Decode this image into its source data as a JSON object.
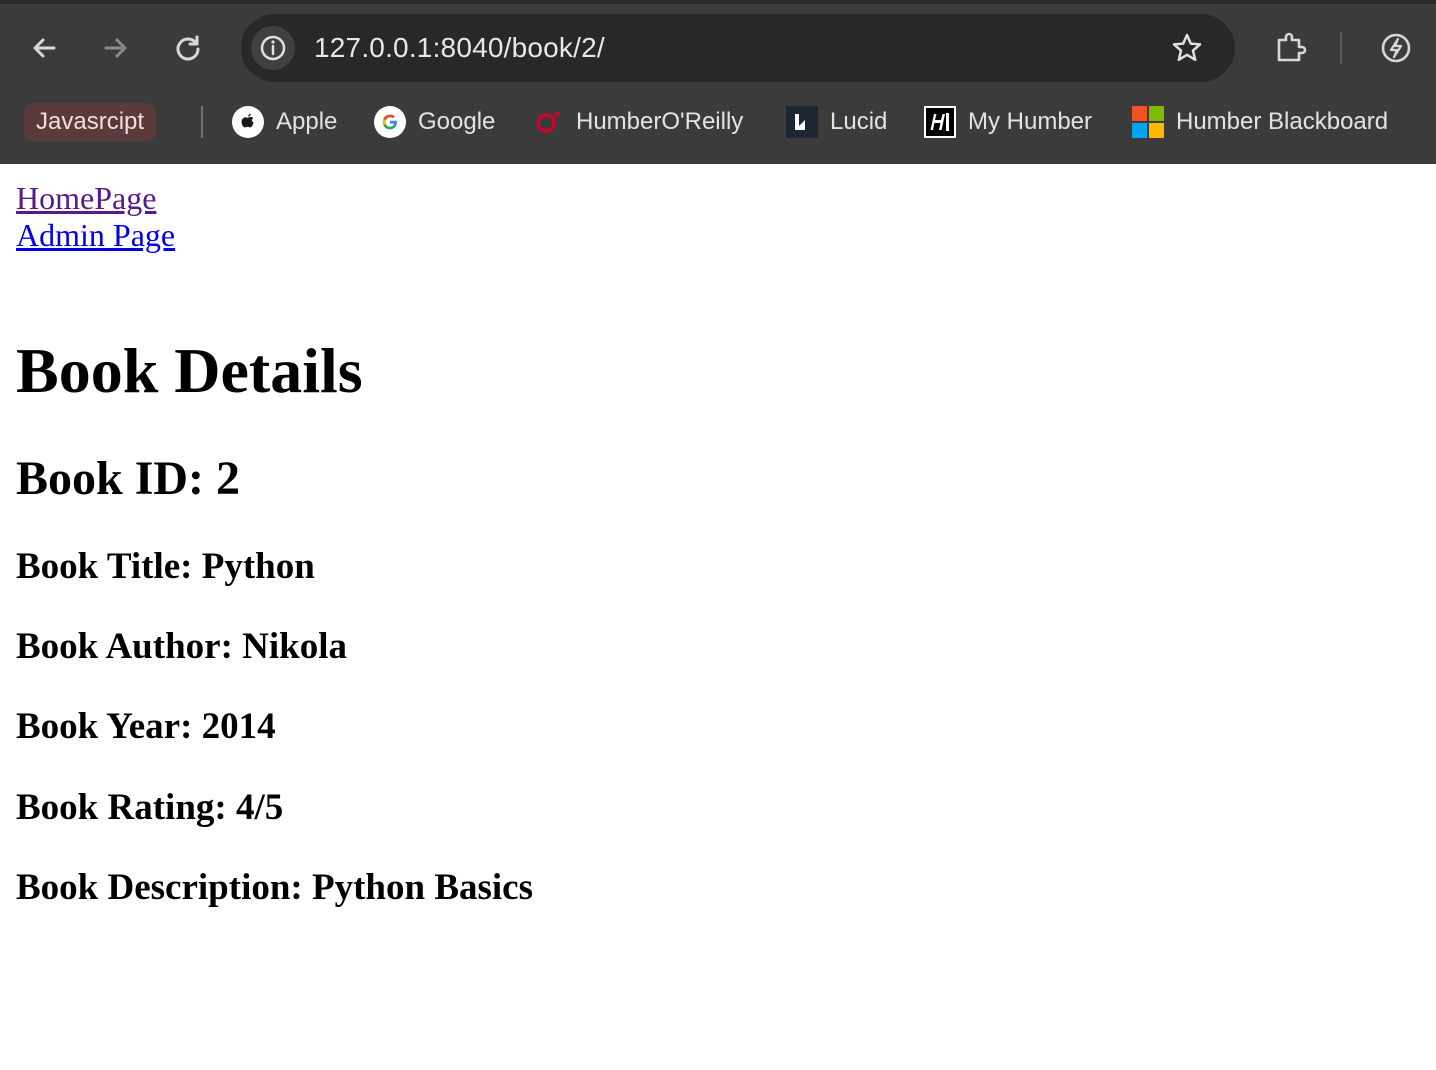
{
  "browser": {
    "url": "127.0.0.1:8040/book/2/",
    "bookmarks": {
      "folder_label": "Javasrcipt",
      "items": [
        {
          "label": "Apple",
          "icon": "apple-icon"
        },
        {
          "label": "Google",
          "icon": "google-icon"
        },
        {
          "label": "HumberO'Reilly",
          "icon": "oreilly-icon"
        },
        {
          "label": "Lucid",
          "icon": "lucid-icon"
        },
        {
          "label": "My Humber",
          "icon": "humber-icon"
        },
        {
          "label": "Humber Blackboard",
          "icon": "microsoft-icon"
        }
      ]
    },
    "toolbar_icons": [
      "back-arrow-icon",
      "forward-arrow-icon",
      "reload-icon",
      "site-info-icon",
      "bookmark-star-icon",
      "extensions-puzzle-icon",
      "performance-leaf-icon"
    ]
  },
  "page": {
    "nav_links": {
      "home": "HomePage",
      "admin": "Admin Page"
    },
    "heading": "Book Details",
    "book_id": "Book ID: 2",
    "title": "Book Title: Python",
    "author": "Book Author: Nikola",
    "year": "Book Year: 2014",
    "rating": "Book Rating: 4/5",
    "description": "Book Description: Python Basics"
  },
  "colors": {
    "chrome_bg": "#3b3b3b",
    "omnibox_bg": "#282828",
    "link_visited": "#551a8b",
    "link_unvisited": "#0000ee"
  }
}
